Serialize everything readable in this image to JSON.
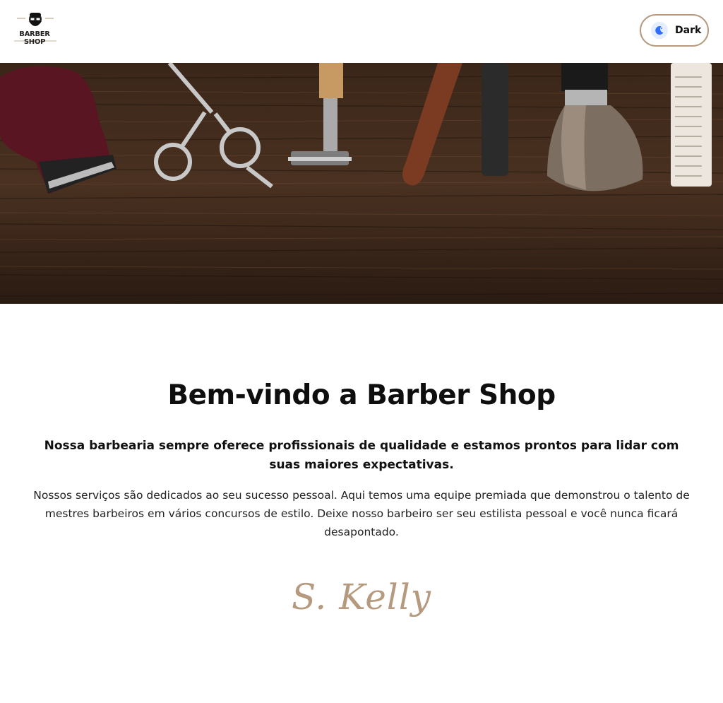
{
  "header": {
    "logo": {
      "text": "BARBER SHOP",
      "icon": "barber-logo-icon"
    },
    "theme_toggle": {
      "label": "Dark",
      "icon": "moon-icon"
    }
  },
  "hero": {
    "image": "barber-tools-on-wood",
    "colors": {
      "wood": "#3b2618",
      "accent": "#b59a7f"
    }
  },
  "main": {
    "title": "Bem-vindo a Barber Shop",
    "lead": "Nossa barbearia sempre oferece profissionais de qualidade e estamos prontos para lidar com suas maiores expectativas.",
    "body": "Nossos serviços são dedicados ao seu sucesso pessoal. Aqui temos uma equipe premiada que demonstrou o talento de mestres barbeiros em vários concursos de estilo. Deixe nosso barbeiro ser seu estilista pessoal e você nunca ficará desapontado.",
    "signature": "S. Kelly"
  }
}
